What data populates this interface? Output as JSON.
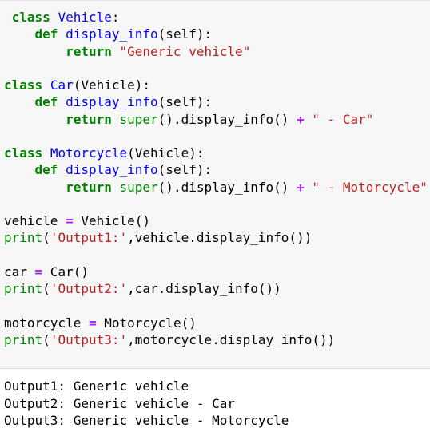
{
  "colors": {
    "keyword": "#008000",
    "name": "#0000ff",
    "string": "#ba2121",
    "operator": "#aa22ff",
    "builtin": "#008000",
    "plain": "#000000",
    "code_background": "#f7f7f7",
    "output_background": "#ffffff"
  },
  "code_lines": [
    [
      {
        "t": " ",
        "k": "plain"
      },
      {
        "t": "class",
        "k": "kw"
      },
      {
        "t": " ",
        "k": "plain"
      },
      {
        "t": "Vehicle",
        "k": "name"
      },
      {
        "t": ":",
        "k": "plain"
      }
    ],
    [
      {
        "t": "    ",
        "k": "plain"
      },
      {
        "t": "def",
        "k": "kw"
      },
      {
        "t": " ",
        "k": "plain"
      },
      {
        "t": "display_info",
        "k": "name"
      },
      {
        "t": "(self):",
        "k": "plain"
      }
    ],
    [
      {
        "t": "        ",
        "k": "plain"
      },
      {
        "t": "return",
        "k": "kw"
      },
      {
        "t": " ",
        "k": "plain"
      },
      {
        "t": "\"Generic vehicle\"",
        "k": "str"
      }
    ],
    [],
    [
      {
        "t": "class",
        "k": "kw"
      },
      {
        "t": " ",
        "k": "plain"
      },
      {
        "t": "Car",
        "k": "name"
      },
      {
        "t": "(Vehicle):",
        "k": "plain"
      }
    ],
    [
      {
        "t": "    ",
        "k": "plain"
      },
      {
        "t": "def",
        "k": "kw"
      },
      {
        "t": " ",
        "k": "plain"
      },
      {
        "t": "display_info",
        "k": "name"
      },
      {
        "t": "(self):",
        "k": "plain"
      }
    ],
    [
      {
        "t": "        ",
        "k": "plain"
      },
      {
        "t": "return",
        "k": "kw"
      },
      {
        "t": " ",
        "k": "plain"
      },
      {
        "t": "super",
        "k": "builtin"
      },
      {
        "t": "().display_info() ",
        "k": "plain"
      },
      {
        "t": "+",
        "k": "op"
      },
      {
        "t": " ",
        "k": "plain"
      },
      {
        "t": "\" - Car\"",
        "k": "str"
      }
    ],
    [],
    [
      {
        "t": "class",
        "k": "kw"
      },
      {
        "t": " ",
        "k": "plain"
      },
      {
        "t": "Motorcycle",
        "k": "name"
      },
      {
        "t": "(Vehicle):",
        "k": "plain"
      }
    ],
    [
      {
        "t": "    ",
        "k": "plain"
      },
      {
        "t": "def",
        "k": "kw"
      },
      {
        "t": " ",
        "k": "plain"
      },
      {
        "t": "display_info",
        "k": "name"
      },
      {
        "t": "(self):",
        "k": "plain"
      }
    ],
    [
      {
        "t": "        ",
        "k": "plain"
      },
      {
        "t": "return",
        "k": "kw"
      },
      {
        "t": " ",
        "k": "plain"
      },
      {
        "t": "super",
        "k": "builtin"
      },
      {
        "t": "().display_info() ",
        "k": "plain"
      },
      {
        "t": "+",
        "k": "op"
      },
      {
        "t": " ",
        "k": "plain"
      },
      {
        "t": "\" - Motorcycle\"",
        "k": "str"
      }
    ],
    [],
    [
      {
        "t": "vehicle ",
        "k": "plain"
      },
      {
        "t": "=",
        "k": "op"
      },
      {
        "t": " Vehicle()",
        "k": "plain"
      }
    ],
    [
      {
        "t": "print",
        "k": "builtin"
      },
      {
        "t": "(",
        "k": "plain"
      },
      {
        "t": "'Output1:'",
        "k": "str"
      },
      {
        "t": ",vehicle.display_info())",
        "k": "plain"
      }
    ],
    [],
    [
      {
        "t": "car ",
        "k": "plain"
      },
      {
        "t": "=",
        "k": "op"
      },
      {
        "t": " Car()",
        "k": "plain"
      }
    ],
    [
      {
        "t": "print",
        "k": "builtin"
      },
      {
        "t": "(",
        "k": "plain"
      },
      {
        "t": "'Output2:'",
        "k": "str"
      },
      {
        "t": ",car.display_info())",
        "k": "plain"
      }
    ],
    [],
    [
      {
        "t": "motorcycle ",
        "k": "plain"
      },
      {
        "t": "=",
        "k": "op"
      },
      {
        "t": " Motorcycle()",
        "k": "plain"
      }
    ],
    [
      {
        "t": "print",
        "k": "builtin"
      },
      {
        "t": "(",
        "k": "plain"
      },
      {
        "t": "'Output3:'",
        "k": "str"
      },
      {
        "t": ",motorcycle.display_info())",
        "k": "plain"
      }
    ]
  ],
  "output_lines": [
    "Output1: Generic vehicle",
    "Output2: Generic vehicle - Car",
    "Output3: Generic vehicle - Motorcycle"
  ]
}
